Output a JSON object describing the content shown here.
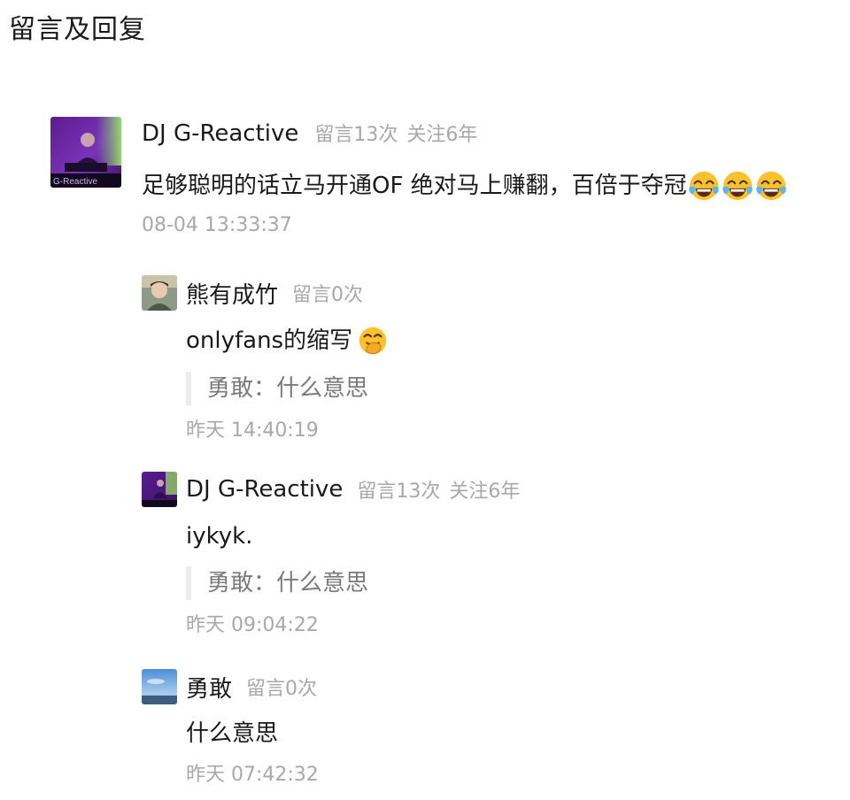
{
  "page": {
    "title": "留言及回复"
  },
  "comment": {
    "author": "DJ G-Reactive",
    "avatar_text": "G-Reactive",
    "message_count": "留言13次",
    "follow_years": "关注6年",
    "text": "足够聪明的话立马开通OF 绝对马上赚翻，百倍于夺冠",
    "emojis": [
      "tears-of-joy-icon",
      "tears-of-joy-icon",
      "tears-of-joy-icon"
    ],
    "time": "08-04 13:33:37"
  },
  "replies": [
    {
      "author": "熊有成竹",
      "message_count": "留言0次",
      "follow_years": "",
      "text": "onlyfans的缩写",
      "emoji": "hand-over-mouth-icon",
      "quote": "勇敢：什么意思",
      "time": "昨天 14:40:19"
    },
    {
      "author": "DJ G-Reactive",
      "message_count": "留言13次",
      "follow_years": "关注6年",
      "text": "iykyk.",
      "quote": "勇敢：什么意思",
      "time": "昨天 09:04:22"
    },
    {
      "author": "勇敢",
      "message_count": "留言0次",
      "follow_years": "",
      "text": "什么意思",
      "time": "昨天 07:42:32"
    }
  ],
  "colors": {
    "primary_text": "#1a1a1a",
    "secondary_text": "#a8a8a8",
    "quote_text": "#7a7a7a",
    "quote_bar": "#ededed"
  }
}
